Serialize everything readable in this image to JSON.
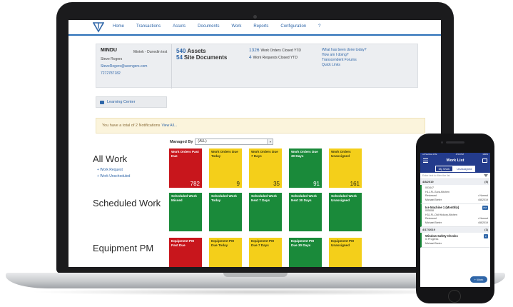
{
  "nav": {
    "items": [
      "Home",
      "Transactions",
      "Assets",
      "Documents",
      "Work",
      "Reports",
      "Configuration",
      "?"
    ]
  },
  "info": {
    "org": "MINDU",
    "site": "Mintek - Dunedin test",
    "user": "Steve Rogers",
    "email": "SteveRogers@avengers.com",
    "phone": "7272787182",
    "assets_count": "540",
    "assets_label": "Assets",
    "docs_count": "54",
    "docs_label": "Site Documents",
    "closed_count": "1326",
    "closed_label": "Work Orders Closed YTD",
    "requests_count": "4",
    "requests_label": "Work Requests Closed YTD",
    "quick_links": [
      "What has been done today?",
      "How am I doing?",
      "Transcendent Forums",
      "Quick Links"
    ]
  },
  "learning_center": "Learning Center",
  "banner": {
    "text": "You have a total of 2 Notifications",
    "link": "View All..."
  },
  "managed_by": {
    "label": "Managed By",
    "value": "(ALL)"
  },
  "sections": {
    "all_work": {
      "title": "All Work",
      "links": [
        "+ Work Request",
        "+ Work Unscheduled"
      ],
      "tiles": [
        {
          "label": "Work Orders Past Due",
          "count": "782",
          "color": "#c8161c"
        },
        {
          "label": "Work Orders Due Today",
          "count": "9",
          "color": "#f4cf1a"
        },
        {
          "label": "Work Orders Due 7 Days",
          "count": "35",
          "color": "#f4cf1a"
        },
        {
          "label": "Work Orders Due 30 Days",
          "count": "91",
          "color": "#1a8a3a"
        },
        {
          "label": "Work Orders Unassigned",
          "count": "161",
          "color": "#f4cf1a"
        }
      ]
    },
    "scheduled": {
      "title": "Scheduled Work",
      "tiles": [
        {
          "label": "Scheduled Work Missed",
          "color": "#1a8a3a"
        },
        {
          "label": "Scheduled Work Today",
          "color": "#1a8a3a"
        },
        {
          "label": "Scheduled Work Next 7 Days",
          "color": "#1a8a3a"
        },
        {
          "label": "Scheduled Work Next 30 Days",
          "color": "#1a8a3a"
        },
        {
          "label": "Scheduled Work Unassigned",
          "color": "#1a8a3a"
        }
      ]
    },
    "equipment": {
      "title": "Equipment PM",
      "tiles": [
        {
          "label": "Equipment PM Past Due",
          "color": "#c8161c"
        },
        {
          "label": "Equipment PM Due Today",
          "color": "#f4cf1a"
        },
        {
          "label": "Equipment PM Due 7 Days",
          "color": "#f4cf1a"
        },
        {
          "label": "Equipment PM Due 30 Days",
          "color": "#1a8a3a"
        },
        {
          "label": "Equipment PM Unassigned",
          "color": "#f4cf1a"
        }
      ]
    }
  },
  "phone": {
    "status_left": "••ll Verizon LTE",
    "status_mid": "4:53 PM",
    "status_right": "100%",
    "title": "Work List",
    "tabs": [
      "My Work",
      "Unassigned"
    ],
    "filter_placeholder": "Enter text to filter the list",
    "groups": [
      {
        "date": "4/8/2019",
        "count": "(5)",
        "cards": [
          {
            "id": "003447",
            "location": "H1-1FL-Sora-Kitchen",
            "status": "Reviewed",
            "priority": "• Normal",
            "user": "Michael Breier",
            "due": "4/8/2019"
          },
          {
            "title": "Ice Machine 1 (Monthly)",
            "badge": "PM",
            "id": "005008",
            "location": "H3-1FL-Old Hickory-Kitchen",
            "status": "Reviewed",
            "priority": "• Normal",
            "user": "Michael Breier",
            "due": "4/8/2019"
          }
        ]
      },
      {
        "date": "4/17/2019",
        "count": "(1)",
        "cards": [
          {
            "title": "Window Safety Checks",
            "badge": "P",
            "status": "In Progress",
            "user": "Michael Breier"
          }
        ]
      }
    ],
    "fab": "+ Work"
  }
}
